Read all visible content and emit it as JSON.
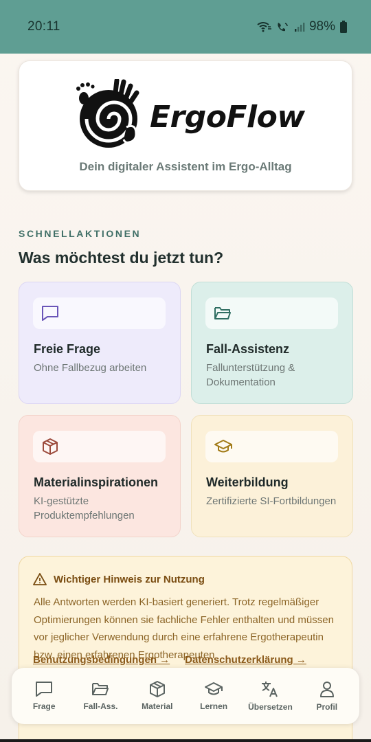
{
  "status_bar": {
    "time": "20:11",
    "battery": "98%"
  },
  "header": {
    "brand": "ErgoFlow",
    "tagline": "Dein digitaler Assistent im Ergo-Alltag"
  },
  "quick_actions": {
    "section_label": "SCHNELLAKTIONEN",
    "title": "Was möchtest du jetzt tun?",
    "tiles": [
      {
        "title": "Freie Frage",
        "subtitle": "Ohne Fallbezug arbeiten",
        "icon": "chat-icon",
        "accent": "#6a55b8"
      },
      {
        "title": "Fall-Assistenz",
        "subtitle": "Fallunterstützung & Dokumentation",
        "icon": "folder-icon",
        "accent": "#2f6e62"
      },
      {
        "title": "Materialinspirationen",
        "subtitle": "KI-gestützte Produktempfehlungen",
        "icon": "box-icon",
        "accent": "#9c4a3c"
      },
      {
        "title": "Weiterbildung",
        "subtitle": "Zertifizierte SI-Fortbildungen",
        "icon": "graduation-cap-icon",
        "accent": "#a27b18"
      }
    ]
  },
  "notice": {
    "title": "Wichtiger Hinweis zur Nutzung",
    "body": "Alle Antworten werden KI-basiert generiert. Trotz regelmäßiger Optimierungen können sie fachliche Fehler enthalten und müssen vor jeglicher Verwendung durch eine erfahrene Ergotherapeutin bzw. einen erfahrenen Ergotherapeuten",
    "links": [
      "Benutzungsbedingungen →",
      "Datenschutzerklärung →"
    ]
  },
  "bottom_nav": {
    "items": [
      {
        "label": "Frage",
        "icon": "chat-icon"
      },
      {
        "label": "Fall-Ass.",
        "icon": "folder-icon"
      },
      {
        "label": "Material",
        "icon": "box-icon"
      },
      {
        "label": "Lernen",
        "icon": "graduation-cap-icon"
      },
      {
        "label": "Übersetzen",
        "icon": "translate-icon"
      },
      {
        "label": "Profil",
        "icon": "user-icon"
      }
    ]
  },
  "colors": {
    "status_bar": "#5f9e93",
    "section_label": "#3f6e66",
    "notice_bg": "#fdf3da",
    "notice_text": "#8b6426"
  }
}
